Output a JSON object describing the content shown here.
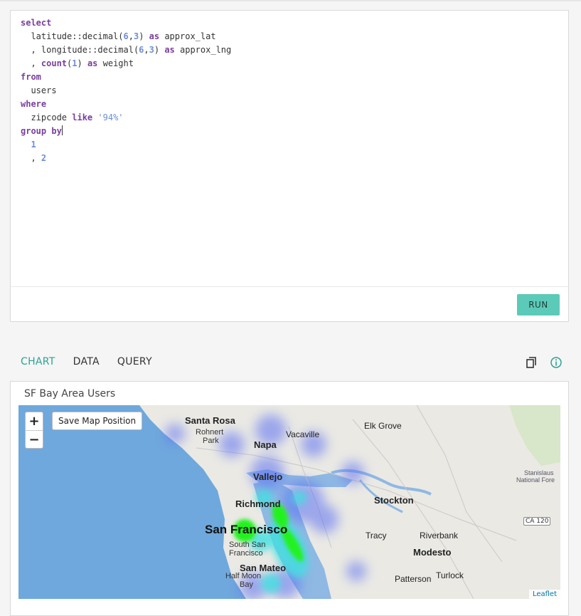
{
  "editor": {
    "lines": [
      [
        {
          "t": "select",
          "c": "kw"
        }
      ],
      [
        {
          "t": "  latitude::decimal(",
          "c": ""
        },
        {
          "t": "6",
          "c": "num"
        },
        {
          "t": ",",
          "c": ""
        },
        {
          "t": "3",
          "c": "num"
        },
        {
          "t": ") ",
          "c": ""
        },
        {
          "t": "as",
          "c": "kw"
        },
        {
          "t": " approx_lat",
          "c": ""
        }
      ],
      [
        {
          "t": "  , longitude::decimal(",
          "c": ""
        },
        {
          "t": "6",
          "c": "num"
        },
        {
          "t": ",",
          "c": ""
        },
        {
          "t": "3",
          "c": "num"
        },
        {
          "t": ") ",
          "c": ""
        },
        {
          "t": "as",
          "c": "kw"
        },
        {
          "t": " approx_lng",
          "c": ""
        }
      ],
      [
        {
          "t": "  , ",
          "c": ""
        },
        {
          "t": "count",
          "c": "fn"
        },
        {
          "t": "(",
          "c": ""
        },
        {
          "t": "1",
          "c": "num"
        },
        {
          "t": ") ",
          "c": ""
        },
        {
          "t": "as",
          "c": "kw"
        },
        {
          "t": " weight",
          "c": ""
        }
      ],
      [
        {
          "t": "from",
          "c": "kw"
        }
      ],
      [
        {
          "t": "  users",
          "c": ""
        }
      ],
      [
        {
          "t": "where",
          "c": "kw"
        }
      ],
      [
        {
          "t": "  zipcode ",
          "c": ""
        },
        {
          "t": "like",
          "c": "kw"
        },
        {
          "t": " ",
          "c": ""
        },
        {
          "t": "'94%'",
          "c": "str"
        }
      ],
      [
        {
          "t": "group by",
          "c": "kw"
        },
        {
          "t": "",
          "c": "caret"
        }
      ],
      [
        {
          "t": "  ",
          "c": ""
        },
        {
          "t": "1",
          "c": "num"
        }
      ],
      [
        {
          "t": "  , ",
          "c": ""
        },
        {
          "t": "2",
          "c": "num"
        }
      ]
    ],
    "run_label": "RUN"
  },
  "tabs": [
    {
      "label": "CHART",
      "active": true
    },
    {
      "label": "DATA",
      "active": false
    },
    {
      "label": "QUERY",
      "active": false
    }
  ],
  "icons": {
    "copy": "copy-icon",
    "info": "info-icon"
  },
  "chart": {
    "title": "SF Bay Area Users",
    "zoom_in": "+",
    "zoom_out": "−",
    "save_position": "Save Map Position",
    "attribution": "Leaflet",
    "places": [
      "Santa Rosa",
      "Rohnert Park",
      "Vacaville",
      "Elk Grove",
      "Napa",
      "Vallejo",
      "Stanislaus National Fore",
      "Richmond",
      "Stockton",
      "San Francisco",
      "South San Francisco",
      "Tracy",
      "Riverbank",
      "Modesto",
      "San Mateo",
      "Half Moon Bay",
      "Patterson",
      "Turlock"
    ],
    "road_badge": "CA 120"
  },
  "colors": {
    "accent": "#5ccab9",
    "tab_active": "#2aa393",
    "water": "#6fa8dc",
    "heat_high": "#00ff00",
    "heat_mid": "#3fe0e0",
    "heat_low": "#5b6ff2"
  }
}
